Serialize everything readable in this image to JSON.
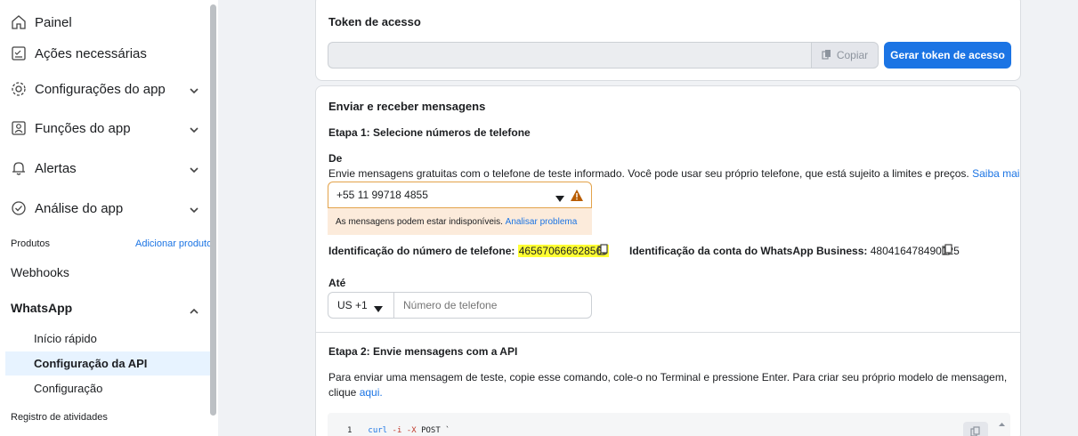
{
  "sidebar": {
    "items": [
      {
        "label": "Painel",
        "icon": "home-icon"
      },
      {
        "label": "Ações necessárias",
        "icon": "checklist-icon"
      },
      {
        "label": "Configurações do app",
        "icon": "gear-icon"
      },
      {
        "label": "Funções do app",
        "icon": "user-badge-icon"
      },
      {
        "label": "Alertas",
        "icon": "bell-icon"
      },
      {
        "label": "Análise do app",
        "icon": "check-circle-icon"
      }
    ],
    "products_label": "Produtos",
    "add_product_label": "Adicionar produto",
    "webhooks_label": "Webhooks",
    "whatsapp_label": "WhatsApp",
    "whatsapp_sub": [
      {
        "label": "Início rápido"
      },
      {
        "label": "Configuração da API"
      },
      {
        "label": "Configuração"
      }
    ],
    "activity_log_label": "Registro de atividades"
  },
  "token_card": {
    "title": "Token de acesso",
    "token_value": "",
    "copy_label": "Copiar",
    "generate_label": "Gerar token de acesso"
  },
  "messages_card": {
    "title": "Enviar e receber mensagens",
    "step1": "Etapa 1: Selecione números de telefone",
    "from_label": "De",
    "from_desc": "Envie mensagens gratuitas com o telefone de teste informado. Você pode usar seu próprio telefone, que está sujeito a limites e preços.",
    "learn_more": "Saiba mais.",
    "from_number": "+55 11 99718 4855",
    "warning_text": "As mensagens podem estar indisponíveis.",
    "analyze_link": "Analisar problema",
    "phone_id_label": "Identificação do número de telefone:",
    "phone_id_value": "465670666628566",
    "waba_id_label": "Identificação da conta do WhatsApp Business:",
    "waba_id_value": "480416478490125",
    "to_label": "Até",
    "country_code": "US +1",
    "phone_placeholder": "Número de telefone",
    "step2": "Etapa 2: Envie mensagens com a API",
    "step2_desc": "Para enviar uma mensagem de teste, copie esse comando, cole-o no Terminal e pressione Enter. Para criar seu próprio modelo de mensagem, clique",
    "here_link": "aqui.",
    "code_line_number": "1",
    "code_cmd": "curl",
    "code_flag1": "-i",
    "code_flag2": "-X",
    "code_rest": "POST `"
  },
  "colors": {
    "accent": "#1b74e4",
    "highlight": "#ffff33",
    "warning_bg": "#fcebdb",
    "warning_icon": "#b85c00"
  }
}
